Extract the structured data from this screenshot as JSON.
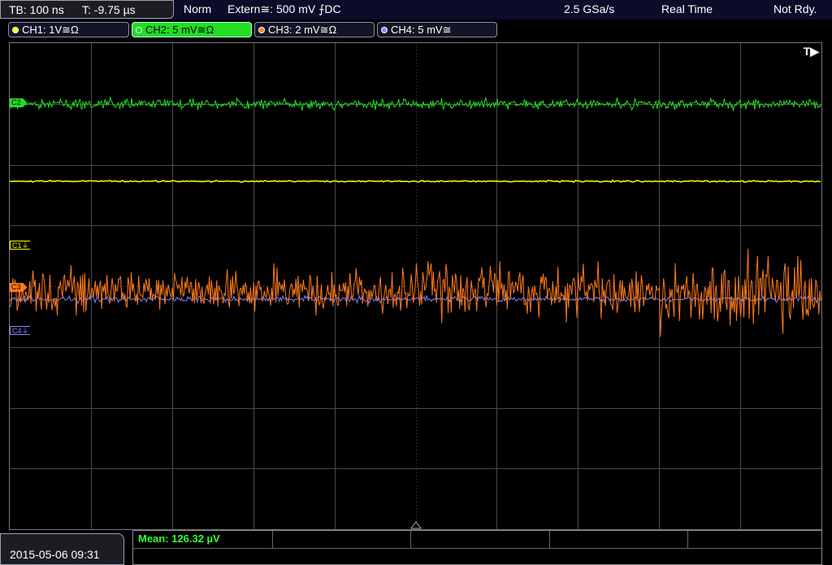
{
  "header": {
    "timebase": "TB: 100 ns",
    "trigger_time": "T: -9.75 µs",
    "acq_mode": "Norm",
    "trigger_source": "Extern≅: 500 mV ⨍DC",
    "sample_rate": "2.5 GSa/s",
    "time_mode": "Real Time",
    "status": "Not Rdy."
  },
  "channels": [
    {
      "label": "CH1: 1V≅Ω",
      "color": "#ffff00",
      "active": false
    },
    {
      "label": "CH2: 5 mV≅Ω",
      "color": "#22dd22",
      "active": true
    },
    {
      "label": "CH3: 2 mV≅Ω",
      "color": "#ff8020",
      "active": false
    },
    {
      "label": "CH4: 5 mV≅",
      "color": "#8888ff",
      "active": false
    }
  ],
  "markers": {
    "c1": "C1⏚",
    "c2": "C2",
    "c3": "C3",
    "c4": "C4⏚"
  },
  "trigger_indicator": "T▶",
  "footer": {
    "datetime": "2015-05-06 09:31",
    "measurement": "Mean: 126.32 µV"
  },
  "colors": {
    "ch1": "#ffff00",
    "ch2": "#22dd22",
    "ch3": "#ff7a1a",
    "ch4": "#7f7fff",
    "grid": "#4a4a4a"
  }
}
